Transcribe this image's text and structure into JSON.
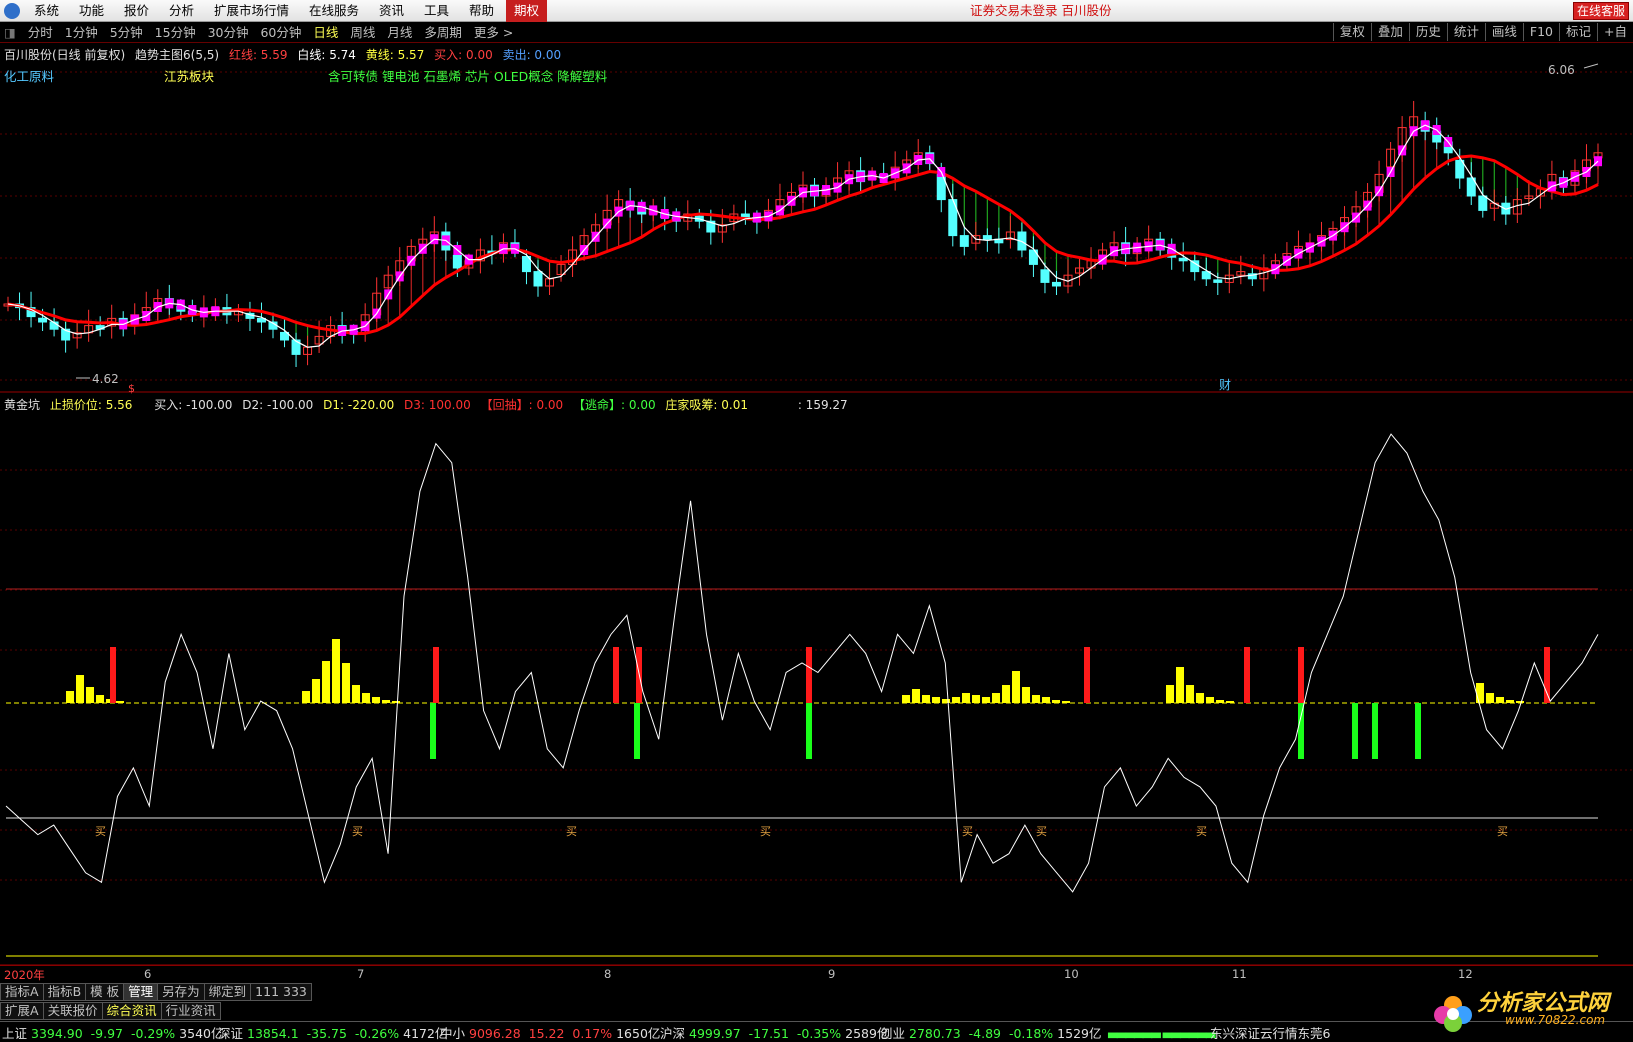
{
  "menu": {
    "items": [
      "系统",
      "功能",
      "报价",
      "分析",
      "扩展市场行情",
      "在线服务",
      "资讯",
      "工具",
      "帮助"
    ],
    "options_label": "期权",
    "notice": "证券交易未登录 百川股份",
    "service_label": "在线客服"
  },
  "periods": {
    "items": [
      "分时",
      "1分钟",
      "5分钟",
      "15分钟",
      "30分钟",
      "60分钟",
      "日线",
      "周线",
      "月线",
      "多周期",
      "更多 >"
    ],
    "active": "日线",
    "right_items": [
      "复权",
      "叠加",
      "历史",
      "统计",
      "画线",
      "F10",
      "标记"
    ],
    "right_tail": "+自"
  },
  "main_info": {
    "stock": "百川股份(日线 前复权)",
    "indicator": "趋势主图6(5,5)",
    "red_line": "红线: 5.59",
    "white_line": "白线: 5.74",
    "yellow_line": "黄线: 5.57",
    "buy": "买入: 0.00",
    "sell": "卖出: 0.00"
  },
  "blocks": {
    "sector1": "化工原料",
    "sector2": "江苏板块",
    "concepts": "含可转债 锂电池 石墨烯 芯片 OLED概念 降解塑料"
  },
  "price_labels": {
    "high": "6.06",
    "low": "4.62",
    "cai_marker": "财",
    "dollar_marker": "$"
  },
  "sub_info": {
    "name": "黄金坑",
    "stop": "止损价位: 5.56",
    "buy": "买入: -100.00",
    "d2": "D2: -100.00",
    "d1": "D1: -220.00",
    "d3": "D3: 100.00",
    "pullback": "【回抽】: 0.00",
    "escape": "【逃命】: 0.00",
    "absorb": "庄家吸筹: 0.01",
    "tail": ": 159.27"
  },
  "buy_label": "买",
  "dates": {
    "year": "2020年",
    "months": [
      "6",
      "7",
      "8",
      "9",
      "10",
      "11",
      "12"
    ]
  },
  "tabs1": [
    "指标A",
    "指标B",
    "模 板",
    "管理",
    "另存为",
    "绑定到",
    "111 333"
  ],
  "tabs1_active": "管理",
  "tabs2": [
    "扩展A",
    "关联报价",
    "综合资讯",
    "行业资讯"
  ],
  "tabs2_active": "综合资讯",
  "ticker": [
    {
      "name": "上证",
      "value": "3394.90",
      "chg": "-9.97",
      "pct": "-0.29%",
      "amt": "3540亿"
    },
    {
      "name": "深证",
      "value": "13854.1",
      "chg": "-35.75",
      "pct": "-0.26%",
      "amt": "4172亿"
    },
    {
      "name": "中小",
      "value": "9096.28",
      "chg": "15.22",
      "pct": "0.17%",
      "amt": "1650亿"
    },
    {
      "name": "沪深",
      "value": "4999.97",
      "chg": "-17.51",
      "pct": "-0.35%",
      "amt": "2589亿"
    },
    {
      "name": "创业",
      "value": "2780.73",
      "chg": "-4.89",
      "pct": "-0.18%",
      "amt": "1529亿"
    }
  ],
  "ticker_tail": "东兴深证云行情东莞6",
  "brand": {
    "text": "分析家公式网",
    "url": "www.70822.com"
  },
  "colors": {
    "up": "#ff4040",
    "down": "#40ff40",
    "candle_up": "#ff3232",
    "candle_down": "#54ffff",
    "ma": "#ff0000",
    "magenta": "#ff00ff",
    "yellow": "#ffff00"
  },
  "chart_data": {
    "type": "candlestick",
    "closes": [
      5.0,
      4.98,
      4.93,
      4.9,
      4.86,
      4.8,
      4.84,
      4.88,
      4.86,
      4.92,
      4.88,
      4.94,
      4.98,
      5.03,
      5.0,
      4.96,
      4.94,
      4.96,
      4.98,
      4.94,
      4.96,
      4.92,
      4.9,
      4.86,
      4.8,
      4.72,
      4.76,
      4.82,
      4.88,
      4.85,
      4.84,
      4.94,
      5.06,
      5.16,
      5.24,
      5.32,
      5.36,
      5.4,
      5.3,
      5.2,
      5.24,
      5.3,
      5.28,
      5.34,
      5.3,
      5.18,
      5.1,
      5.14,
      5.22,
      5.3,
      5.38,
      5.44,
      5.52,
      5.58,
      5.54,
      5.5,
      5.52,
      5.48,
      5.46,
      5.5,
      5.46,
      5.4,
      5.44,
      5.5,
      5.48,
      5.46,
      5.52,
      5.58,
      5.62,
      5.66,
      5.6,
      5.64,
      5.7,
      5.74,
      5.68,
      5.72,
      5.7,
      5.76,
      5.8,
      5.84,
      5.78,
      5.58,
      5.38,
      5.32,
      5.38,
      5.36,
      5.34,
      5.4,
      5.3,
      5.22,
      5.12,
      5.1,
      5.16,
      5.2,
      5.24,
      5.3,
      5.34,
      5.28,
      5.32,
      5.36,
      5.3,
      5.26,
      5.24,
      5.18,
      5.14,
      5.12,
      5.16,
      5.18,
      5.14,
      5.2,
      5.24,
      5.28,
      5.32,
      5.34,
      5.38,
      5.42,
      5.48,
      5.54,
      5.62,
      5.72,
      5.86,
      5.98,
      6.04,
      5.96,
      5.9,
      5.84,
      5.7,
      5.6,
      5.52,
      5.56,
      5.5,
      5.58,
      5.6,
      5.64,
      5.72,
      5.66,
      5.74,
      5.8,
      5.84
    ],
    "red_line_last": 5.59,
    "white_line_last": 5.74,
    "yellow_line_last": 5.57,
    "price_high": 6.06,
    "price_low": 4.62,
    "sub_white": [
      -120,
      -135,
      -150,
      -140,
      -165,
      -190,
      -200,
      -110,
      -80,
      -120,
      10,
      60,
      20,
      -60,
      40,
      -40,
      -10,
      -20,
      -60,
      -130,
      -200,
      -160,
      -100,
      -70,
      -170,
      100,
      210,
      260,
      240,
      120,
      -20,
      -60,
      0,
      20,
      -60,
      -80,
      -20,
      30,
      60,
      80,
      0,
      -50,
      80,
      200,
      60,
      -30,
      40,
      -10,
      -40,
      20,
      30,
      20,
      40,
      60,
      40,
      0,
      60,
      40,
      90,
      30,
      -200,
      -150,
      -180,
      -170,
      -140,
      -170,
      -190,
      -210,
      -180,
      -100,
      -80,
      -120,
      -100,
      -70,
      -90,
      -100,
      -120,
      -180,
      -200,
      -130,
      -80,
      -50,
      20,
      60,
      100,
      170,
      240,
      270,
      250,
      210,
      180,
      120,
      20,
      -40,
      -60,
      -20,
      30,
      -10,
      10,
      30,
      60
    ],
    "sub_y_range": [
      -250,
      290
    ]
  }
}
